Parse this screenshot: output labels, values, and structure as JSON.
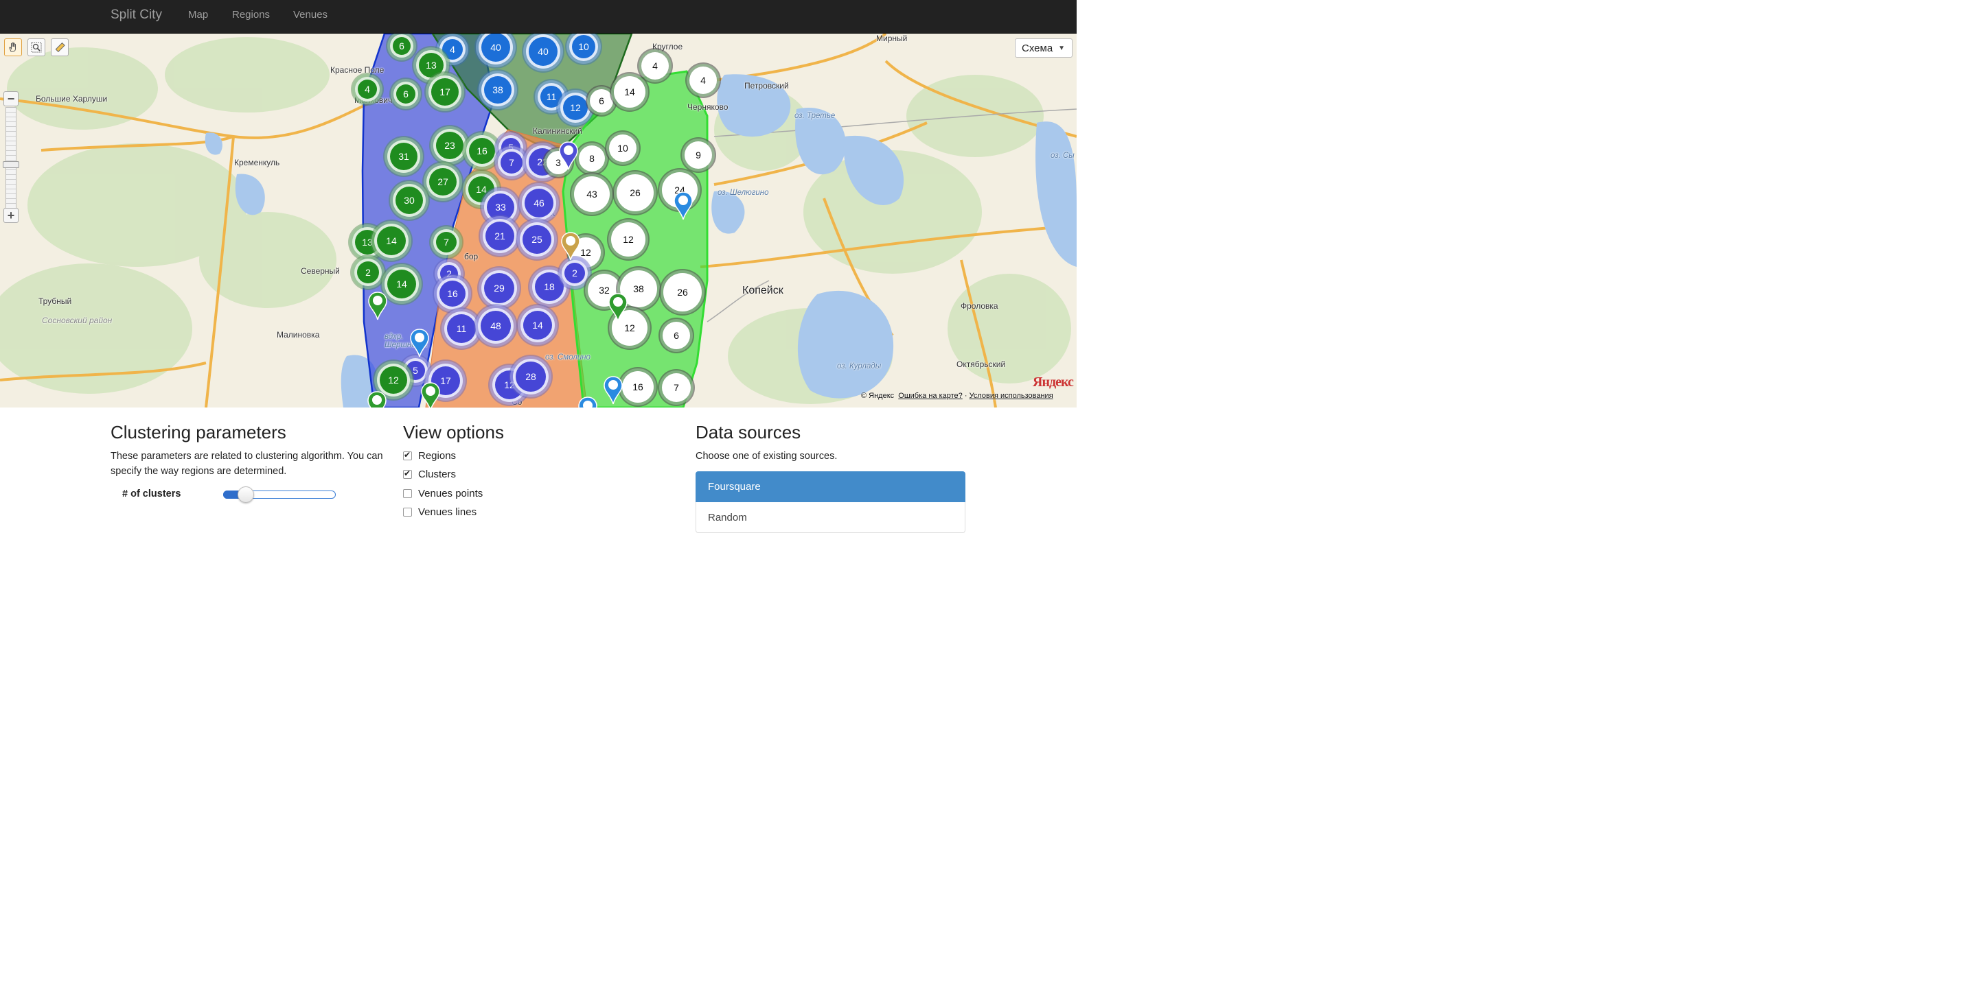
{
  "navbar": {
    "brand": "Split City",
    "links": [
      "Map",
      "Regions",
      "Venues"
    ]
  },
  "map": {
    "layer_button": "Схема",
    "places": {
      "mirny": "Мирный",
      "krugloe": "Круглое",
      "krasnoe_pole": "Красное Поле",
      "petrovsky": "Петровский",
      "bolshie_kharlushi": "Большие Харлуши",
      "chernyakovo": "Черняково",
      "malkovichi": "Малкович",
      "oz_trete": "оз. Третье",
      "kalininsky": "Калининский",
      "kremenkul": "Кременкуль",
      "oz_sy": "оз. Сы",
      "oz_sheligino": "оз. Шелюгино",
      "severny": "Северный",
      "kopeysk": "Копейск",
      "trubny": "Трубный",
      "frolovka": "Фроловка",
      "sosnovsky": "Сосновский район",
      "malinovka": "Малиновка",
      "vdkhr": "вдхр.",
      "shershnevskoe": "Шершневск",
      "oz_smolino": "оз. Смолино",
      "oz_kurlady": "оз. Курлады",
      "oktyabrsky": "Октябрьский",
      "tsk": "ск",
      "bor": "бор",
      "so": "Со"
    },
    "clusters": [
      {
        "n": "6",
        "c": "green"
      },
      {
        "n": "4",
        "c": "blue"
      },
      {
        "n": "40",
        "c": "blue"
      },
      {
        "n": "40",
        "c": "blue"
      },
      {
        "n": "10",
        "c": "blue"
      },
      {
        "n": "13",
        "c": "green"
      },
      {
        "n": "4",
        "c": "green"
      },
      {
        "n": "6",
        "c": "green"
      },
      {
        "n": "17",
        "c": "green"
      },
      {
        "n": "38",
        "c": "blue"
      },
      {
        "n": "11",
        "c": "blue"
      },
      {
        "n": "12",
        "c": "blue"
      },
      {
        "n": "6",
        "c": "white"
      },
      {
        "n": "14",
        "c": "white"
      },
      {
        "n": "4",
        "c": "white"
      },
      {
        "n": "4",
        "c": "white"
      },
      {
        "n": "31",
        "c": "green"
      },
      {
        "n": "23",
        "c": "green"
      },
      {
        "n": "16",
        "c": "green"
      },
      {
        "n": "5",
        "c": "indigo"
      },
      {
        "n": "7",
        "c": "indigo"
      },
      {
        "n": "22",
        "c": "indigo"
      },
      {
        "n": "3",
        "c": "white"
      },
      {
        "n": "8",
        "c": "white"
      },
      {
        "n": "10",
        "c": "white"
      },
      {
        "n": "9",
        "c": "white"
      },
      {
        "n": "27",
        "c": "green"
      },
      {
        "n": "14",
        "c": "green"
      },
      {
        "n": "30",
        "c": "green"
      },
      {
        "n": "33",
        "c": "indigo"
      },
      {
        "n": "46",
        "c": "indigo"
      },
      {
        "n": "43",
        "c": "white"
      },
      {
        "n": "26",
        "c": "white"
      },
      {
        "n": "24",
        "c": "white"
      },
      {
        "n": "13",
        "c": "green"
      },
      {
        "n": "14",
        "c": "green"
      },
      {
        "n": "7",
        "c": "green"
      },
      {
        "n": "21",
        "c": "indigo"
      },
      {
        "n": "25",
        "c": "indigo"
      },
      {
        "n": "12",
        "c": "white"
      },
      {
        "n": "12",
        "c": "white"
      },
      {
        "n": "2",
        "c": "green"
      },
      {
        "n": "14",
        "c": "green"
      },
      {
        "n": "2",
        "c": "indigo"
      },
      {
        "n": "16",
        "c": "indigo"
      },
      {
        "n": "29",
        "c": "indigo"
      },
      {
        "n": "18",
        "c": "indigo"
      },
      {
        "n": "2",
        "c": "indigo"
      },
      {
        "n": "32",
        "c": "white"
      },
      {
        "n": "38",
        "c": "white"
      },
      {
        "n": "26",
        "c": "white"
      },
      {
        "n": "11",
        "c": "indigo"
      },
      {
        "n": "48",
        "c": "indigo"
      },
      {
        "n": "14",
        "c": "indigo"
      },
      {
        "n": "12",
        "c": "white"
      },
      {
        "n": "6",
        "c": "white"
      },
      {
        "n": "5",
        "c": "indigo"
      },
      {
        "n": "12",
        "c": "green"
      },
      {
        "n": "17",
        "c": "indigo"
      },
      {
        "n": "12",
        "c": "indigo"
      },
      {
        "n": "28",
        "c": "indigo"
      },
      {
        "n": "16",
        "c": "white"
      },
      {
        "n": "7",
        "c": "white"
      }
    ],
    "copyright": "© Яндекс",
    "error_link": "Ошибка на карте?",
    "separator": " · ",
    "terms_link": "Условия использования",
    "logo": "Яндекс"
  },
  "clustering": {
    "title": "Clustering parameters",
    "description": "These parameters are related to clustering algorithm. You can specify the way regions are determined.",
    "slider_label": "# of clusters",
    "slider_value_fraction": 0.2
  },
  "view_options": {
    "title": "View options",
    "options": [
      {
        "label": "Regions",
        "checked": true
      },
      {
        "label": "Clusters",
        "checked": true
      },
      {
        "label": "Venues points",
        "checked": false
      },
      {
        "label": "Venues lines",
        "checked": false
      }
    ]
  },
  "data_sources": {
    "title": "Data sources",
    "description": "Choose one of existing sources.",
    "sources": [
      "Foursquare",
      "Random"
    ],
    "active": "Foursquare"
  },
  "colors": {
    "navbar": "#222222",
    "region_blue": "#3344e0",
    "region_darkgreen": "#2f7a2f",
    "region_orange": "#f08a4b",
    "region_green": "#33dd33",
    "active_source": "#428bca"
  }
}
